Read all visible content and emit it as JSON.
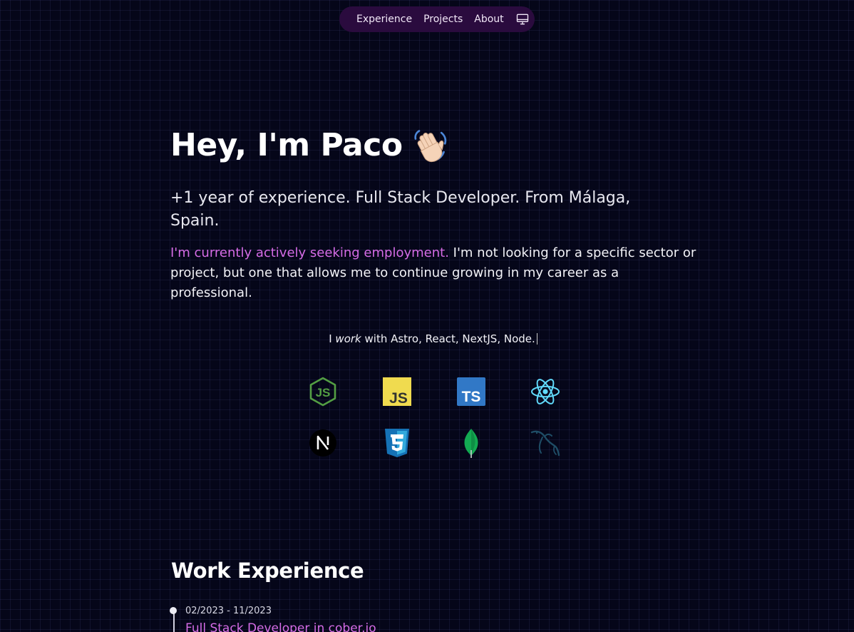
{
  "nav": {
    "items": [
      {
        "label": "Experience"
      },
      {
        "label": "Projects"
      },
      {
        "label": "About"
      }
    ],
    "theme_icon": "monitor-icon"
  },
  "hero": {
    "title": "Hey, I'm Paco",
    "emoji": "waving-hand-icon",
    "subtitle": "+1 year of experience. Full Stack Developer. From Málaga, Spain.",
    "highlight": "I'm currently actively seeking employment.",
    "description": " I'm not looking for a specific sector or project, but one that allows me to continue growing in my career as a professional."
  },
  "work_with": {
    "prefix": "I ",
    "verb": "work",
    "suffix": " with Astro, React, NextJS, Node."
  },
  "tech_icons": [
    "nodejs-icon",
    "javascript-icon",
    "typescript-icon",
    "react-icon",
    "nextjs-icon",
    "css3-icon",
    "mongodb-icon",
    "mysql-icon"
  ],
  "experience": {
    "heading": "Work Experience",
    "jobs": [
      {
        "date": "02/2023 - 11/2023",
        "title": "Full Stack Developer in cober.io"
      }
    ]
  },
  "colors": {
    "accent": "#d56ce6",
    "nav_bg": "#2a0b3e",
    "background": "#050619"
  }
}
